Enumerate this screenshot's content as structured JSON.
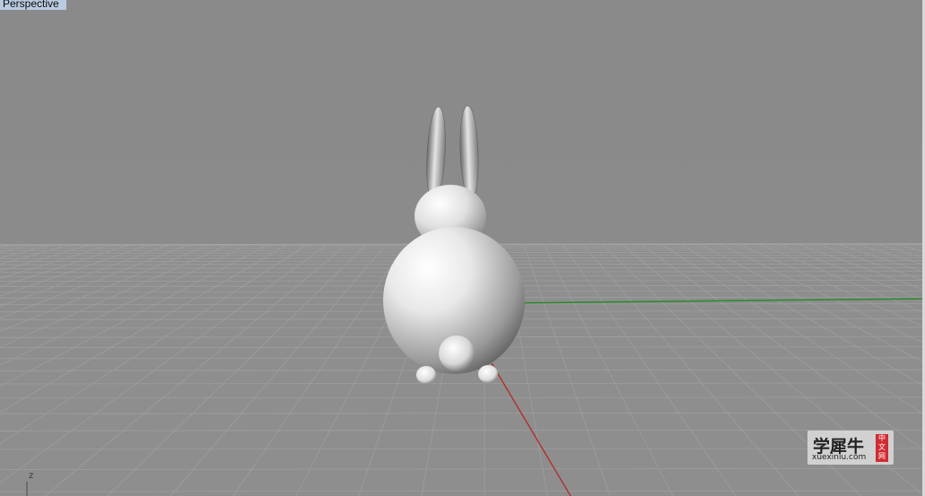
{
  "viewport": {
    "label": "Perspective",
    "axis_indicator": "z"
  },
  "scene": {
    "object": "rabbit-model",
    "background_color": "#8a8a8a",
    "grid_color": "#9c9c9c",
    "x_axis_color": "#b03030",
    "y_axis_color": "#2f8a2f"
  },
  "watermark": {
    "title": "学犀牛",
    "url": "xuexiniu.com",
    "badge": [
      "中",
      "文",
      "网"
    ],
    "badge_color": "#d12b32"
  }
}
